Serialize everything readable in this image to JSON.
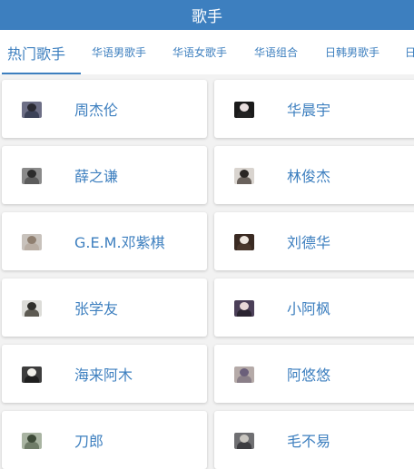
{
  "header": {
    "title": "歌手"
  },
  "tabs": [
    {
      "label": "热门歌手",
      "active": true
    },
    {
      "label": "华语男歌手",
      "active": false
    },
    {
      "label": "华语女歌手",
      "active": false
    },
    {
      "label": "华语组合",
      "active": false
    },
    {
      "label": "日韩男歌手",
      "active": false
    },
    {
      "label": "日",
      "active": false
    }
  ],
  "singers": [
    {
      "name": "周杰伦",
      "avatar_colors": [
        "#6d6f86",
        "#2b2b33",
        "#3c4258"
      ]
    },
    {
      "name": "华晨宇",
      "avatar_colors": [
        "#1a1a1a",
        "#e8dede",
        "#222222"
      ]
    },
    {
      "name": "薛之谦",
      "avatar_colors": [
        "#8a8a8a",
        "#2c2c2c",
        "#5c5c5c"
      ]
    },
    {
      "name": "林俊杰",
      "avatar_colors": [
        "#d9d4cf",
        "#2a2624",
        "#6a625c"
      ]
    },
    {
      "name": "G.E.M.邓紫棋",
      "avatar_colors": [
        "#c8c2bc",
        "#8f7f70",
        "#b9aea4"
      ]
    },
    {
      "name": "刘德华",
      "avatar_colors": [
        "#3a2a22",
        "#efe7df",
        "#4a372c"
      ]
    },
    {
      "name": "张学友",
      "avatar_colors": [
        "#dcdcd8",
        "#2f2f2b",
        "#5d5a52"
      ]
    },
    {
      "name": "小阿枫",
      "avatar_colors": [
        "#4b3f58",
        "#e8d8d8",
        "#2a2430"
      ]
    },
    {
      "name": "海来阿木",
      "avatar_colors": [
        "#3d3d3d",
        "#f0efe9",
        "#1f1f1f"
      ]
    },
    {
      "name": "阿悠悠",
      "avatar_colors": [
        "#b5aaa8",
        "#6b5f7a",
        "#8a7f88"
      ]
    },
    {
      "name": "刀郎",
      "avatar_colors": [
        "#a9b4a2",
        "#3d4a38",
        "#6f7c68"
      ]
    },
    {
      "name": "毛不易",
      "avatar_colors": [
        "#6f6f72",
        "#c9c6c0",
        "#3e3e42"
      ]
    }
  ]
}
